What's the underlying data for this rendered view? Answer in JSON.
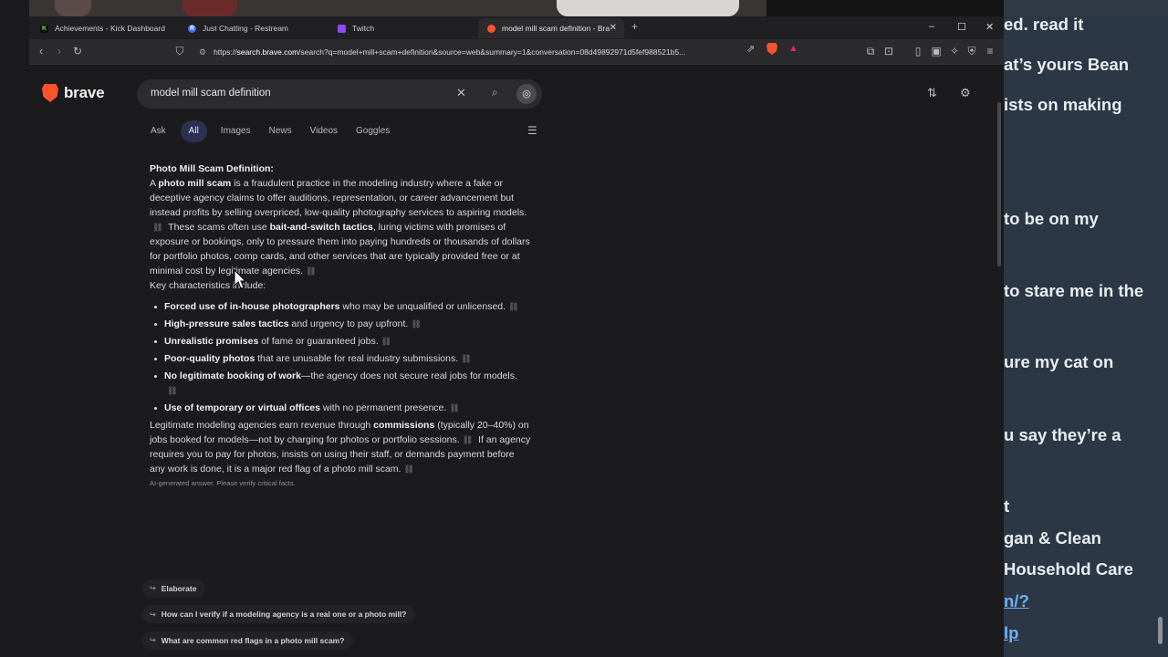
{
  "browser": {
    "tabs": [
      {
        "title": "Achievements - Kick Dashboard",
        "favicon": "kick-icon",
        "color": "#53fc18",
        "active": false
      },
      {
        "title": "Just Chatting - Restream",
        "favicon": "restream-icon",
        "color": "#3e6ef5",
        "active": false
      },
      {
        "title": "Twitch",
        "favicon": "twitch-icon",
        "color": "#9146ff",
        "active": false
      },
      {
        "title": "model mill scam definition - Bra",
        "favicon": "brave-icon",
        "color": "#fb542b",
        "active": true
      }
    ],
    "url_prefix": "https://",
    "url_host": "search.brave.com",
    "url_rest": "/search?q=model+mill+scam+definition&source=web&summary=1&conversation=08d49892971d5fef988521b5..."
  },
  "search": {
    "logo_text": "brave",
    "query": "model mill scam definition",
    "tabs": [
      "Ask",
      "All",
      "Images",
      "News",
      "Videos",
      "Goggles"
    ],
    "active_tab": "All"
  },
  "answer": {
    "heading": "Photo Mill Scam Definition:",
    "p1_a": "A ",
    "p1_b": "photo mill scam",
    "p1_c": " is a fraudulent practice in the modeling industry where a fake or deceptive agency claims to offer auditions, representation, or career advancement but instead profits by selling overpriced, low-quality photography services to aspiring models.",
    "p1_d": " These scams often use ",
    "p1_e": "bait-and-switch tactics",
    "p1_f": ", luring victims with promises of exposure or bookings, only to pressure them into paying hundreds or thousands of dollars for portfolio photos, comp cards, and other services that are typically provided free or at minimal cost by legitimate agencies.",
    "keys_label": "Key characteristics include:",
    "bullets": [
      {
        "bold": "Forced use of in-house photographers",
        "rest": " who may be unqualified or unlicensed."
      },
      {
        "bold": "High-pressure sales tactics",
        "rest": " and urgency to pay upfront."
      },
      {
        "bold": "Unrealistic promises",
        "rest": " of fame or guaranteed jobs."
      },
      {
        "bold": "Poor-quality photos",
        "rest": " that are unusable for real industry submissions."
      },
      {
        "bold": "No legitimate booking of work",
        "rest": "—the agency does not secure real jobs for models."
      },
      {
        "bold": "Use of temporary or virtual offices",
        "rest": " with no permanent presence."
      }
    ],
    "p3_a": "Legitimate modeling agencies earn revenue through ",
    "p3_b": "commissions",
    "p3_c": " (typically 20–40%) on jobs booked for models—not by charging for photos or portfolio sessions.",
    "p3_d": " If an agency requires you to pay for photos, insists on using their staff, or demands payment before any work is done, it is a major red flag of a photo mill scam.",
    "disclaimer": "AI-generated answer. Please verify critical facts."
  },
  "followups": [
    "Elaborate",
    "How can I verify if a modeling agency is a real one or a photo mill?",
    "What are common red flags in a photo mill scam?"
  ],
  "chat": {
    "lines": [
      "ed. read it",
      "at’s yours Bean",
      "ists on making",
      "to be on my",
      "to stare me in the",
      "ure my cat on",
      "u say they’re a",
      "t",
      "gan & Clean",
      "Household Care",
      "n/?",
      "lp"
    ]
  }
}
